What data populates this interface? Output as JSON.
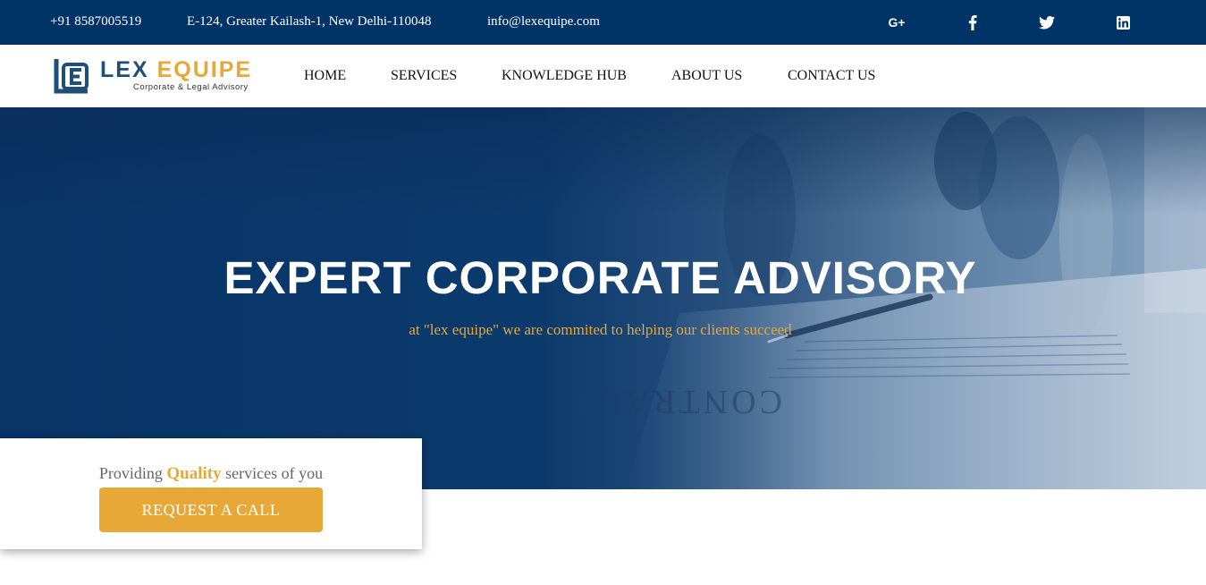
{
  "topbar": {
    "phone": "+91 8587005519",
    "address": "E-124, Greater Kailash-1, New Delhi-110048",
    "email": "info@lexequipe.com",
    "social": [
      "google-plus-icon",
      "facebook-icon",
      "twitter-icon",
      "linkedin-icon"
    ],
    "gplus_label": "G+"
  },
  "logo": {
    "word1": "LEX",
    "word2": "EQUIPE",
    "tagline": "Corporate & Legal Advisory"
  },
  "nav": {
    "home": "HOME",
    "services": "SERVICES",
    "knowledge_hub": "KNOWLEDGE HUB",
    "about": "ABOUT US",
    "contact": "CONTACT US"
  },
  "hero": {
    "title": "EXPERT CORPORATE ADVISORY",
    "subtitle": "at \"lex equipe\" we are commited to helping our clients succeed",
    "background_text": "CONTRACT"
  },
  "card": {
    "text_before": "Providing ",
    "highlight": "Quality",
    "text_after": " services of you",
    "button_label": "REQUEST A CALL"
  },
  "colors": {
    "navy": "#003366",
    "accent": "#e8a838",
    "logo_blue": "#1f4e79"
  }
}
